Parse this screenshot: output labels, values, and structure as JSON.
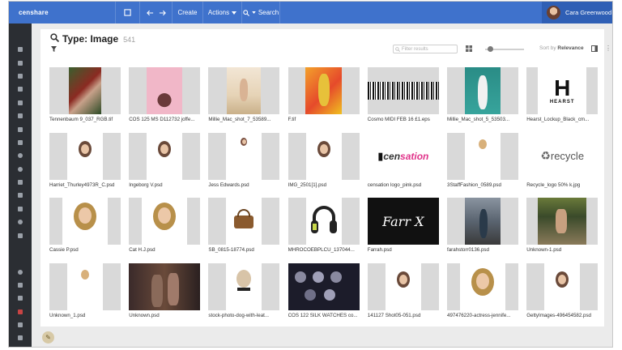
{
  "topbar": {
    "brand": "censhare",
    "create_label": "Create",
    "actions_label": "Actions",
    "search_label": "Search",
    "user_name": "Cara Greenwood"
  },
  "colors": {
    "topbar": "#3f72cc",
    "sidebar": "#2b2e33",
    "accent": "#c84444"
  },
  "search_header": {
    "title": "Type: Image",
    "count": "541",
    "filter_placeholder": "Filter results",
    "sort_prefix": "Sort by",
    "sort_value": "Relevance"
  },
  "sidebar_icons": [
    "home-icon",
    "inbox-icon",
    "download-icon",
    "calendar-icon",
    "chat-icon",
    "folder-icon",
    "tag-icon",
    "clock-icon",
    "heart-icon",
    "layers-icon",
    "document-icon",
    "file-icon",
    "search-icon",
    "trash-icon",
    "search-icon",
    "image-icon",
    "film-icon",
    "alert-icon",
    "grid-icon",
    "settings-icon"
  ],
  "assets": [
    {
      "name": "Tennenbaum 9_037_RGB.tif",
      "style": "img-photo-red"
    },
    {
      "name": "COS 125 MS D112732 joffe...",
      "style": "img-pink-cup"
    },
    {
      "name": "Millie_Mac_shot_7_53589...",
      "style": "img-beach"
    },
    {
      "name": "F.tif",
      "style": "img-orange"
    },
    {
      "name": "Cosmo MIDI FEB 16 £1.eps",
      "style": "img-barcode"
    },
    {
      "name": "Millie_Mac_shot_5_53503...",
      "style": "img-teal"
    },
    {
      "name": "Hearst_Lockup_Black_cm...",
      "style": "img-hearst"
    },
    {
      "name": "Harriet_Thurley4973R_C.psd",
      "style": "img-cutout"
    },
    {
      "name": "Ingeborg V.psd",
      "style": "img-cutout"
    },
    {
      "name": "Jess Edwards.psd",
      "style": "img-cutout-small"
    },
    {
      "name": "IMG_2501[1].psd",
      "style": "img-cutout"
    },
    {
      "name": "censation logo_pink.psd",
      "style": "img-censation"
    },
    {
      "name": "3StaffFashion_0589.psd",
      "style": "img-cutout-tiny"
    },
    {
      "name": "Recycle_logo 50% k.jpg",
      "style": "img-recycle"
    },
    {
      "name": "Cassie P.psd",
      "style": "img-cutout-wide"
    },
    {
      "name": "Cat H.J.psd",
      "style": "img-cutout-wide"
    },
    {
      "name": "SB_0815-18774.psd",
      "style": "img-bag"
    },
    {
      "name": "MHROCOEBPLCU_137044...",
      "style": "img-headphones"
    },
    {
      "name": "Farrah.psd",
      "style": "img-farrah"
    },
    {
      "name": "farahstorr0136.psd",
      "style": "img-street"
    },
    {
      "name": "Unknown-1.psd",
      "style": "img-gym"
    },
    {
      "name": "Unknown_1.psd",
      "style": "img-cutout-tiny"
    },
    {
      "name": "Unknown.psd",
      "style": "img-party"
    },
    {
      "name": "stock-photo-dog-with-leat...",
      "style": "img-dog"
    },
    {
      "name": "COS 122 SILK WATCHES co...",
      "style": "img-watches"
    },
    {
      "name": "141127 Shot05-051.psd",
      "style": "img-cutout"
    },
    {
      "name": "497476220-actress-jennife...",
      "style": "img-cutout-wide"
    },
    {
      "name": "GettyImages-496454582.psd",
      "style": "img-cutout"
    }
  ]
}
